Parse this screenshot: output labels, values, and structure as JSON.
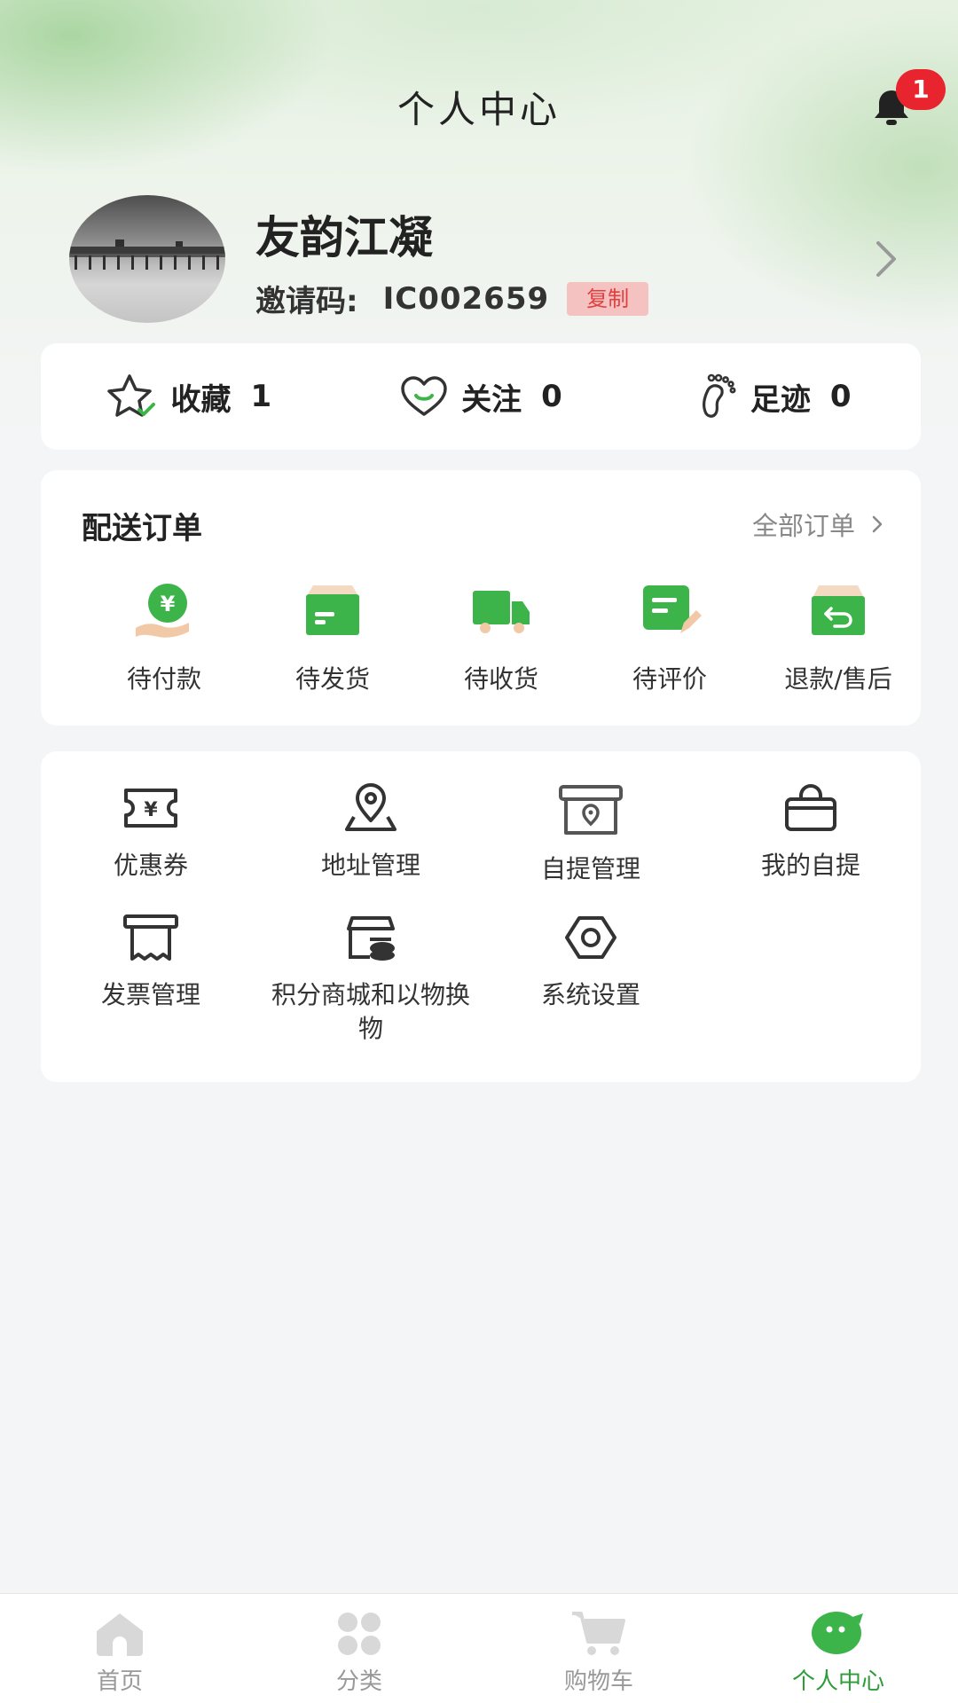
{
  "header": {
    "title": "个人中心",
    "notification_count": "1"
  },
  "profile": {
    "name": "友韵江凝",
    "invite_label": "邀请码:",
    "invite_code": "IC002659",
    "copy_label": "复制"
  },
  "stats": [
    {
      "label": "收藏",
      "value": "1",
      "icon": "star-icon"
    },
    {
      "label": "关注",
      "value": "0",
      "icon": "heart-icon"
    },
    {
      "label": "足迹",
      "value": "0",
      "icon": "footprint-icon"
    }
  ],
  "orders": {
    "title": "配送订单",
    "all_label": "全部订单",
    "items": [
      {
        "label": "待付款",
        "icon": "payment-icon"
      },
      {
        "label": "待发货",
        "icon": "box-icon"
      },
      {
        "label": "待收货",
        "icon": "truck-icon"
      },
      {
        "label": "待评价",
        "icon": "review-icon"
      },
      {
        "label": "退款/售后",
        "icon": "refund-icon"
      }
    ]
  },
  "services": [
    {
      "label": "优惠券",
      "icon": "coupon-icon"
    },
    {
      "label": "地址管理",
      "icon": "location-icon"
    },
    {
      "label": "自提管理",
      "icon": "pickup-store-icon"
    },
    {
      "label": "我的自提",
      "icon": "bag-icon"
    },
    {
      "label": "发票管理",
      "icon": "invoice-icon"
    },
    {
      "label": "积分商城和以物换物",
      "icon": "points-mall-icon"
    },
    {
      "label": "系统设置",
      "icon": "settings-icon"
    }
  ],
  "tabbar": [
    {
      "label": "首页",
      "icon": "home-icon"
    },
    {
      "label": "分类",
      "icon": "category-icon"
    },
    {
      "label": "购物车",
      "icon": "cart-icon"
    },
    {
      "label": "个人中心",
      "icon": "profile-icon",
      "active": true
    }
  ],
  "colors": {
    "accent": "#3cb44a",
    "active_tab": "#2e9c3a",
    "badge": "#e8252f",
    "copy_bg": "#f5c2c2",
    "copy_text": "#e0403f"
  }
}
